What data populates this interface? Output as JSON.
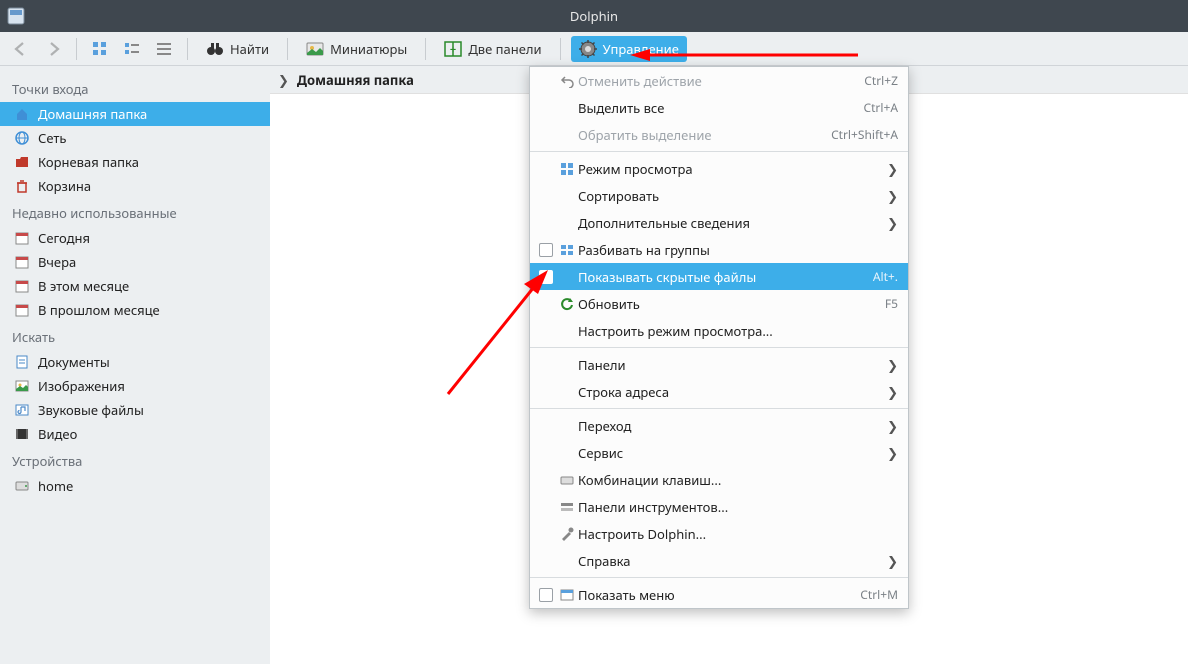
{
  "title": "Dolphin",
  "toolbar": {
    "find": "Найти",
    "thumbnails": "Миниатюры",
    "two_panels": "Две панели",
    "manage": "Управление"
  },
  "breadcrumb": "Домашняя папка",
  "sidebar": {
    "sections": [
      {
        "header": "Точки входа",
        "items": [
          {
            "label": "Домашняя папка",
            "icon": "home-icon",
            "selected": true
          },
          {
            "label": "Сеть",
            "icon": "network-icon"
          },
          {
            "label": "Корневая папка",
            "icon": "root-icon"
          },
          {
            "label": "Корзина",
            "icon": "trash-icon"
          }
        ]
      },
      {
        "header": "Недавно использованные",
        "items": [
          {
            "label": "Сегодня",
            "icon": "calendar-icon"
          },
          {
            "label": "Вчера",
            "icon": "calendar-icon"
          },
          {
            "label": "В этом месяце",
            "icon": "calendar-icon"
          },
          {
            "label": "В прошлом месяце",
            "icon": "calendar-icon"
          }
        ]
      },
      {
        "header": "Искать",
        "items": [
          {
            "label": "Документы",
            "icon": "doc-icon"
          },
          {
            "label": "Изображения",
            "icon": "image-icon"
          },
          {
            "label": "Звуковые файлы",
            "icon": "audio-icon"
          },
          {
            "label": "Видео",
            "icon": "video-icon"
          }
        ]
      },
      {
        "header": "Устройства",
        "items": [
          {
            "label": "home",
            "icon": "disk-icon"
          }
        ]
      }
    ]
  },
  "menu": [
    {
      "type": "item",
      "label": "Отменить действие",
      "accel": "Ctrl+Z",
      "disabled": true,
      "icon": "undo-icon"
    },
    {
      "type": "item",
      "label": "Выделить все",
      "accel": "Ctrl+A"
    },
    {
      "type": "item",
      "label": "Обратить выделение",
      "accel": "Ctrl+Shift+A",
      "disabled": true
    },
    {
      "type": "sep"
    },
    {
      "type": "item",
      "label": "Режим просмотра",
      "submenu": true,
      "icon": "viewmode-icon"
    },
    {
      "type": "item",
      "label": "Сортировать",
      "submenu": true
    },
    {
      "type": "item",
      "label": "Дополнительные сведения",
      "submenu": true
    },
    {
      "type": "item",
      "label": "Разбивать на группы",
      "checkbox": true,
      "icon": "group-icon"
    },
    {
      "type": "item",
      "label": "Показывать скрытые файлы",
      "accel": "Alt+.",
      "checkbox": true,
      "highlight": true
    },
    {
      "type": "item",
      "label": "Обновить",
      "accel": "F5",
      "icon": "refresh-icon"
    },
    {
      "type": "item",
      "label": "Настроить режим просмотра..."
    },
    {
      "type": "sep"
    },
    {
      "type": "item",
      "label": "Панели",
      "submenu": true
    },
    {
      "type": "item",
      "label": "Строка адреса",
      "submenu": true
    },
    {
      "type": "sep"
    },
    {
      "type": "item",
      "label": "Переход",
      "submenu": true
    },
    {
      "type": "item",
      "label": "Сервис",
      "submenu": true
    },
    {
      "type": "item",
      "label": "Комбинации клавиш...",
      "icon": "shortcuts-icon"
    },
    {
      "type": "item",
      "label": "Панели инструментов...",
      "icon": "toolbars-icon"
    },
    {
      "type": "item",
      "label": "Настроить Dolphin...",
      "icon": "configure-icon"
    },
    {
      "type": "item",
      "label": "Справка",
      "submenu": true
    },
    {
      "type": "sep"
    },
    {
      "type": "item",
      "label": "Показать меню",
      "accel": "Ctrl+M",
      "checkbox": true,
      "icon": "menu-icon"
    }
  ]
}
